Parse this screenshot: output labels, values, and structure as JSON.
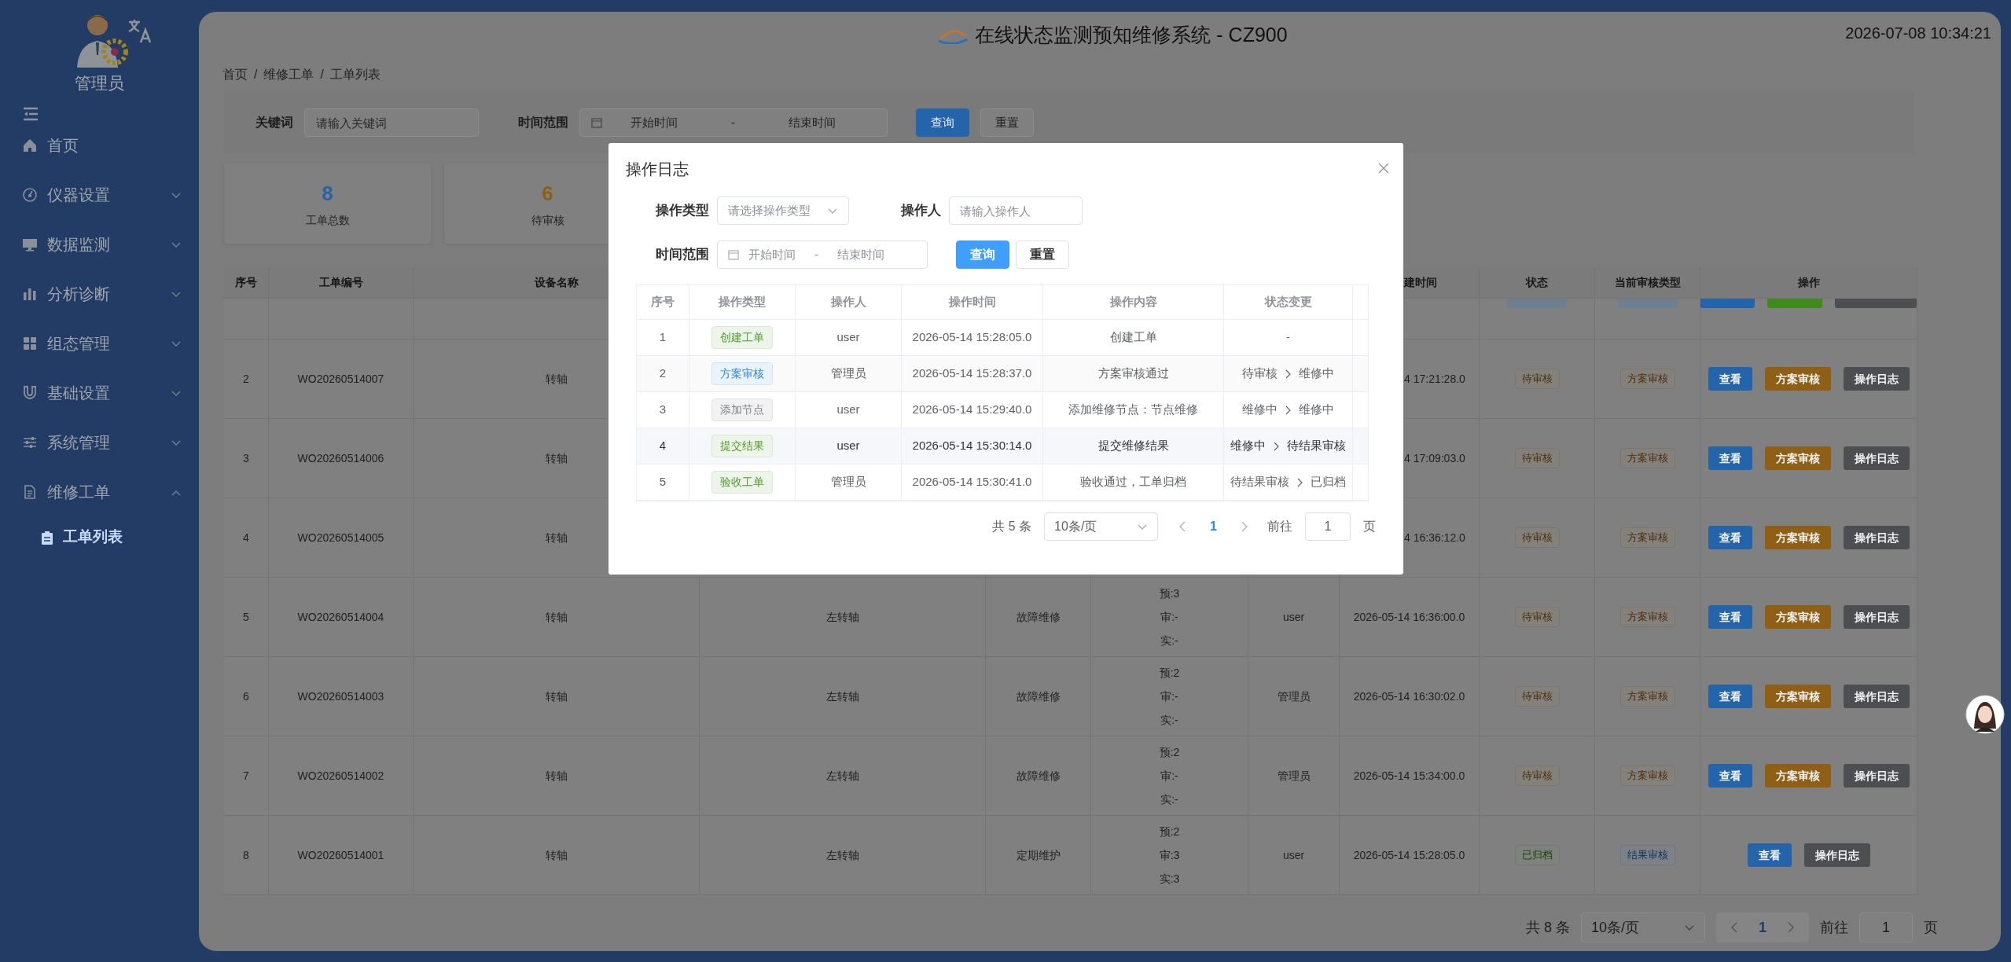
{
  "sidebar": {
    "user": "管理员",
    "items": [
      {
        "label": "首页",
        "expandable": false
      },
      {
        "label": "仪器设置",
        "expandable": true,
        "expanded": false
      },
      {
        "label": "数据监测",
        "expandable": true,
        "expanded": false
      },
      {
        "label": "分析诊断",
        "expandable": true,
        "expanded": false
      },
      {
        "label": "组态管理",
        "expandable": true,
        "expanded": false
      },
      {
        "label": "基础设置",
        "expandable": true,
        "expanded": false
      },
      {
        "label": "系统管理",
        "expandable": true,
        "expanded": false
      },
      {
        "label": "维修工单",
        "expandable": true,
        "expanded": true,
        "children": [
          {
            "label": "工单列表",
            "selected": true
          }
        ]
      }
    ]
  },
  "header": {
    "title": "在线状态监测预知维修系统 - CZ900",
    "datetime": "2026-07-08 10:34:21"
  },
  "breadcrumb": [
    {
      "label": "首页",
      "separator": "/"
    },
    {
      "label": "维修工单",
      "separator": "/"
    },
    {
      "label": "工单列表"
    }
  ],
  "filters": {
    "keyword": {
      "label": "关键词",
      "placeholder": "请输入关键词"
    },
    "time_range": {
      "label": "时间范围",
      "start_placeholder": "开始时间",
      "separator": "-",
      "end_placeholder": "结束时间"
    },
    "buttons": [
      {
        "label": "查询"
      },
      {
        "label": "重置"
      }
    ]
  },
  "stats": [
    {
      "value": "8",
      "label": "工单总数",
      "color": "#2a62a0"
    },
    {
      "value": "6",
      "label": "待审核",
      "color": "#8f5e16"
    }
  ],
  "table": {
    "headers": {
      "no": "序号",
      "order_no": "工单编号",
      "device": "设备名称",
      "time_clipped": "建时间",
      "status": "状态",
      "review": "当前审核类型",
      "actions": "操作"
    },
    "rows": [
      {
        "kind": "clipped",
        "status": {
          "color": "#6f7f92"
        },
        "review": {
          "color": "#6f7f92"
        },
        "actions": [
          {
            "color": "#2464ab"
          },
          {
            "color": "#3f8a1c"
          },
          {
            "color": "#4d4e52"
          }
        ]
      },
      {
        "kind": "covered",
        "no": "2",
        "order_no": "WO20260514007",
        "device": "转轴",
        "time_clipped": "4 17:21:28.0",
        "status": {
          "label": "待审核",
          "color": "#4a2f08"
        },
        "review": {
          "label": "方案审核",
          "color": "#4a2f08"
        },
        "actions": [
          {
            "label": "查看",
            "color": "#2464ab"
          },
          {
            "label": "方案审核",
            "color": "#8f5f15"
          },
          {
            "label": "操作日志",
            "color": "#4d4e52"
          }
        ]
      },
      {
        "kind": "covered",
        "no": "3",
        "order_no": "WO20260514006",
        "device": "转轴",
        "time_clipped": "4 17:09:03.0",
        "status": {
          "label": "待审核",
          "color": "#4a2f08"
        },
        "review": {
          "label": "方案审核",
          "color": "#4a2f08"
        },
        "actions": [
          {
            "label": "查看",
            "color": "#2464ab"
          },
          {
            "label": "方案审核",
            "color": "#8f5f15"
          },
          {
            "label": "操作日志",
            "color": "#4d4e52"
          }
        ]
      },
      {
        "kind": "covered",
        "no": "4",
        "order_no": "WO20260514005",
        "device": "转轴",
        "time_clipped": "4 16:36:12.0",
        "status": {
          "label": "待审核",
          "color": "#4a2f08"
        },
        "review": {
          "label": "方案审核",
          "color": "#4a2f08"
        },
        "actions": [
          {
            "label": "查看",
            "color": "#2464ab"
          },
          {
            "label": "方案审核",
            "color": "#8f5f15"
          },
          {
            "label": "操作日志",
            "color": "#4d4e52"
          }
        ]
      },
      {
        "kind": "full",
        "no": "5",
        "order_no": "WO20260514004",
        "device": "转轴",
        "point": "左转轴",
        "type": "故障维修",
        "plan": [
          "预:3",
          "审:-",
          "实:-"
        ],
        "operator": "user",
        "time": "2026-05-14 16:36:00.0",
        "status": {
          "label": "待审核",
          "color": "#4a2f08"
        },
        "review": {
          "label": "方案审核",
          "color": "#4a2f08"
        },
        "actions": [
          {
            "label": "查看",
            "color": "#2464ab"
          },
          {
            "label": "方案审核",
            "color": "#8f5f15"
          },
          {
            "label": "操作日志",
            "color": "#4d4e52"
          }
        ]
      },
      {
        "kind": "full",
        "no": "6",
        "order_no": "WO20260514003",
        "device": "转轴",
        "point": "左转轴",
        "type": "故障维修",
        "plan": [
          "预:2",
          "审:-",
          "实:-"
        ],
        "operator": "管理员",
        "time": "2026-05-14 16:30:02.0",
        "status": {
          "label": "待审核",
          "color": "#4a2f08"
        },
        "review": {
          "label": "方案审核",
          "color": "#4a2f08"
        },
        "actions": [
          {
            "label": "查看",
            "color": "#2464ab"
          },
          {
            "label": "方案审核",
            "color": "#8f5f15"
          },
          {
            "label": "操作日志",
            "color": "#4d4e52"
          }
        ]
      },
      {
        "kind": "full",
        "no": "7",
        "order_no": "WO20260514002",
        "device": "转轴",
        "point": "左转轴",
        "type": "故障维修",
        "plan": [
          "预:2",
          "审:-",
          "实:-"
        ],
        "operator": "管理员",
        "time": "2026-05-14 15:34:00.0",
        "status": {
          "label": "待审核",
          "color": "#4a2f08"
        },
        "review": {
          "label": "方案审核",
          "color": "#4a2f08"
        },
        "actions": [
          {
            "label": "查看",
            "color": "#2464ab"
          },
          {
            "label": "方案审核",
            "color": "#8f5f15"
          },
          {
            "label": "操作日志",
            "color": "#4d4e52"
          }
        ]
      },
      {
        "kind": "full",
        "no": "8",
        "order_no": "WO20260514001",
        "device": "转轴",
        "point": "左转轴",
        "type": "定期维护",
        "plan": [
          "预:2",
          "审:3",
          "实:3"
        ],
        "operator": "user",
        "time": "2026-05-14 15:28:05.0",
        "status": {
          "label": "已归档",
          "color": "#1a3f0a"
        },
        "review": {
          "label": "结果审核",
          "color": "#0f3560"
        },
        "actions": [
          {
            "label": "查看",
            "color": "#2464ab"
          },
          {
            "label": "操作日志",
            "color": "#4d4e52"
          }
        ]
      }
    ]
  },
  "pagination": {
    "total": "共 8 条",
    "page_size": "10条/页",
    "pages": [
      {
        "label": "1",
        "selected": true
      }
    ],
    "goto_label": "前往",
    "goto_value": "1",
    "unit": "页"
  },
  "modal": {
    "title": "操作日志",
    "form": {
      "type_label": "操作类型",
      "type_placeholder": "请选择操作类型",
      "operator_label": "操作人",
      "operator_placeholder": "请输入操作人",
      "time_label": "时间范围",
      "start_placeholder": "开始时间",
      "separator": "-",
      "end_placeholder": "结束时间",
      "buttons": [
        {
          "label": "查询"
        },
        {
          "label": "重置"
        }
      ]
    },
    "columns": [
      "序号",
      "操作类型",
      "操作人",
      "操作时间",
      "操作内容",
      "状态变更"
    ],
    "rows": [
      {
        "no": "1",
        "tag": {
          "label": "创建工单",
          "color": "#4e9a2a"
        },
        "operator": "user",
        "time": "2026-05-14 15:28:05.0",
        "content": "创建工单",
        "change": {
          "kind": "none",
          "text": "-"
        },
        "hovered": false
      },
      {
        "no": "2",
        "tag": {
          "label": "方案审核",
          "color": "#2f86e0"
        },
        "operator": "管理员",
        "time": "2026-05-14 15:28:37.0",
        "content": "方案审核通过",
        "change": {
          "kind": "transition",
          "from": "待审核",
          "to": "维修中"
        },
        "hovered": false
      },
      {
        "no": "3",
        "tag": {
          "label": "添加节点",
          "color": "#7d8087"
        },
        "operator": "user",
        "time": "2026-05-14 15:29:40.0",
        "content": "添加维修节点：节点维修",
        "change": {
          "kind": "transition",
          "from": "维修中",
          "to": "维修中"
        },
        "hovered": false
      },
      {
        "no": "4",
        "tag": {
          "label": "提交结果",
          "color": "#4e9a2a"
        },
        "operator": "user",
        "time": "2026-05-14 15:30:14.0",
        "content": "提交维修结果",
        "change": {
          "kind": "transition",
          "from": "维修中",
          "to": "待结果审核"
        },
        "hovered": true
      },
      {
        "no": "5",
        "tag": {
          "label": "验收工单",
          "color": "#4e9a2a"
        },
        "operator": "管理员",
        "time": "2026-05-14 15:30:41.0",
        "content": "验收通过，工单归档",
        "change": {
          "kind": "transition",
          "from": "待结果审核",
          "to": "已归档"
        },
        "hovered": false
      }
    ],
    "pagination": {
      "total": "共 5 条",
      "page_size": "10条/页",
      "pages": [
        {
          "label": "1",
          "selected": true
        }
      ],
      "goto_label": "前往",
      "goto_value": "1",
      "unit": "页"
    }
  }
}
